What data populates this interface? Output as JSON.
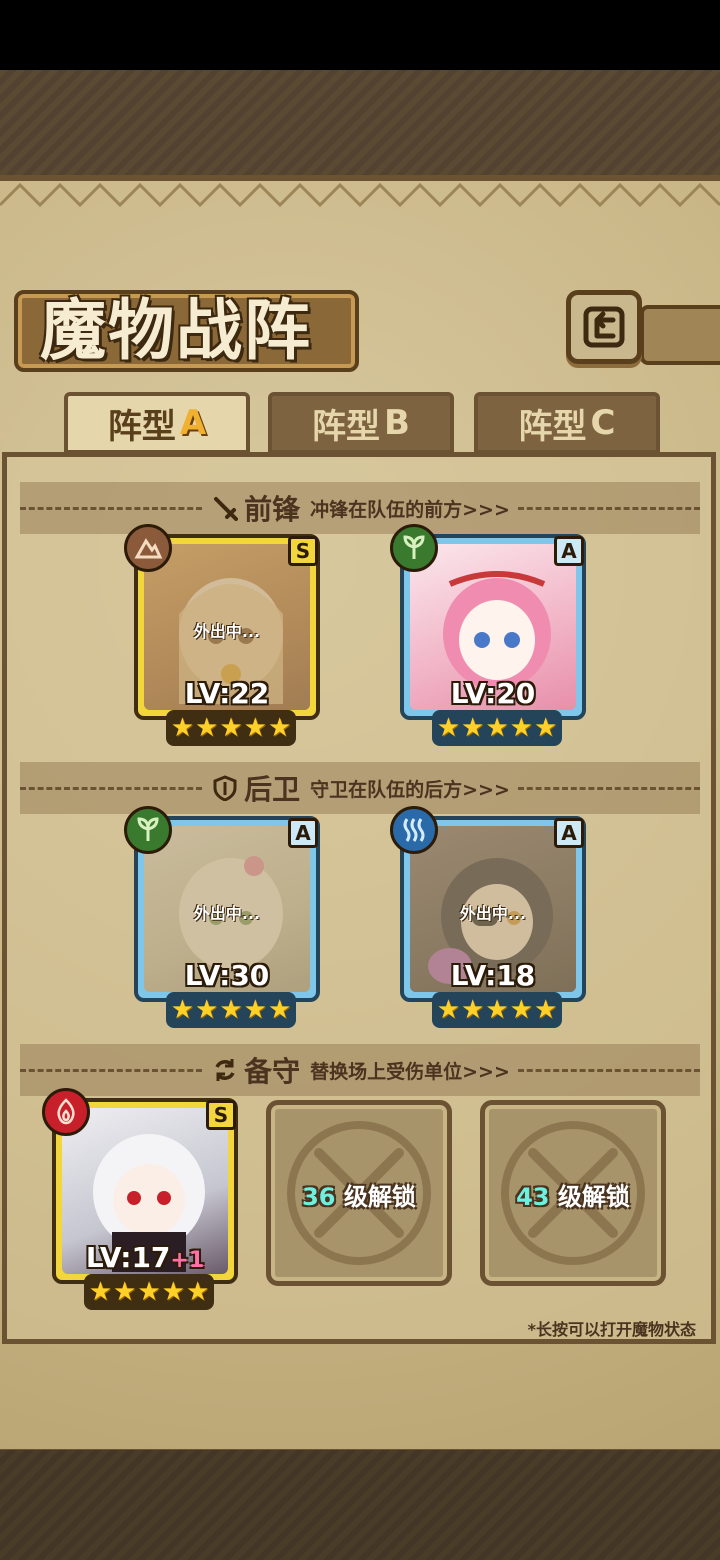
{
  "header": {
    "title": "魔物战阵"
  },
  "tabs": [
    {
      "label": "阵型",
      "letter": "A",
      "active": true
    },
    {
      "label": "阵型",
      "letter": "B",
      "active": false
    },
    {
      "label": "阵型",
      "letter": "C",
      "active": false
    }
  ],
  "sections": {
    "front": {
      "title": "前锋",
      "desc": "冲锋在队伍的前方>>>"
    },
    "back": {
      "title": "后卫",
      "desc": "守卫在队伍的后方>>>"
    },
    "reserve": {
      "title": "备守",
      "desc": "替换场上受伤单位>>>"
    }
  },
  "units": {
    "front1": {
      "rank": "S",
      "element": "earth-icon",
      "level": "LV:22",
      "status": "外出中...",
      "stars": 5
    },
    "front2": {
      "rank": "A",
      "element": "leaf-icon",
      "level": "LV:20",
      "status": "",
      "stars": 5
    },
    "back1": {
      "rank": "A",
      "element": "leaf-icon",
      "level": "LV:30",
      "status": "外出中...",
      "stars": 5
    },
    "back2": {
      "rank": "A",
      "element": "water-icon",
      "level": "LV:18",
      "status": "外出中...",
      "stars": 5
    },
    "reserve1": {
      "rank": "S",
      "element": "fire-icon",
      "level": "LV:17",
      "bonus": "+1",
      "stars": 5
    }
  },
  "locked_slots": [
    {
      "level": "36",
      "text": "级解锁"
    },
    {
      "level": "43",
      "text": "级解锁"
    }
  ],
  "footnote": "*长按可以打开魔物状态",
  "colors": {
    "gold_frame": "#f2d63c",
    "blue_frame": "#7fc7ea",
    "parchment": "#c8b585",
    "tab_letter": "#f0b030"
  }
}
